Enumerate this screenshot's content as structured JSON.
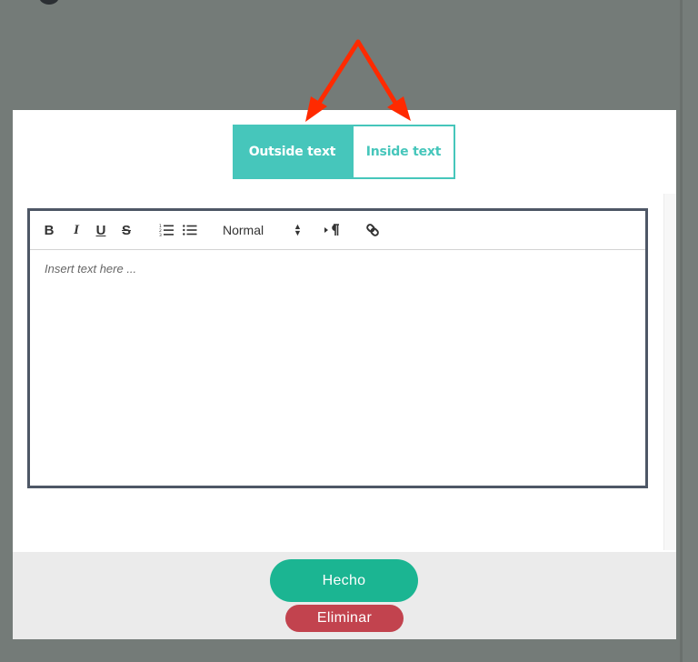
{
  "tabs": {
    "outside_label": "Outside text",
    "inside_label": "Inside text"
  },
  "toolbar": {
    "bold": "B",
    "italic": "I",
    "underline": "U",
    "strike": "S",
    "heading_select": "Normal"
  },
  "editor": {
    "placeholder": "Insert text here ..."
  },
  "footer": {
    "done_label": "Hecho",
    "delete_label": "Eliminar"
  },
  "colors": {
    "accent": "#46c6bb",
    "done": "#1bb592",
    "delete": "#c2434e",
    "arrow": "#ff2a00"
  }
}
